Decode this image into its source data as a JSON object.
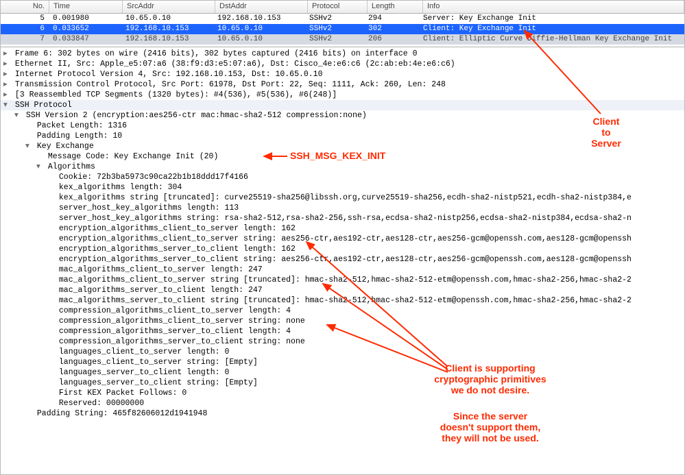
{
  "columns": [
    "No.",
    "Time",
    "SrcAddr",
    "DstAddr",
    "Protocol",
    "Length",
    "Info"
  ],
  "rows": [
    {
      "no": "5",
      "time": "0.001980",
      "src": "10.65.0.10",
      "dst": "192.168.10.153",
      "proto": "SSHv2",
      "len": "294",
      "info": "Server: Key Exchange Init",
      "state": "plain"
    },
    {
      "no": "6",
      "time": "0.033652",
      "src": "192.168.10.153",
      "dst": "10.65.0.10",
      "proto": "SSHv2",
      "len": "302",
      "info": "Client: Key Exchange Init",
      "state": "selected"
    },
    {
      "no": "7",
      "time": "0.033847",
      "src": "192.168.10.153",
      "dst": "10.65.0.10",
      "proto": "SSHv2",
      "len": "206",
      "info": "Client: Elliptic Curve Diffie-Hellman Key Exchange Init",
      "state": "dim"
    }
  ],
  "tree": [
    {
      "t": ">",
      "d": 0,
      "txt": "Frame 6: 302 bytes on wire (2416 bits), 302 bytes captured (2416 bits) on interface 0"
    },
    {
      "t": ">",
      "d": 0,
      "txt": "Ethernet II, Src: Apple_e5:07:a6 (38:f9:d3:e5:07:a6), Dst: Cisco_4e:e6:c6 (2c:ab:eb:4e:e6:c6)"
    },
    {
      "t": ">",
      "d": 0,
      "txt": "Internet Protocol Version 4, Src: 192.168.10.153, Dst: 10.65.0.10"
    },
    {
      "t": ">",
      "d": 0,
      "txt": "Transmission Control Protocol, Src Port: 61978, Dst Port: 22, Seq: 1111, Ack: 260, Len: 248"
    },
    {
      "t": ">",
      "d": 0,
      "txt": "[3 Reassembled TCP Segments (1320 bytes): #4(536), #5(536), #6(248)]"
    },
    {
      "t": "v",
      "d": 0,
      "txt": "SSH Protocol",
      "hl": true
    },
    {
      "t": "v",
      "d": 1,
      "txt": "SSH Version 2 (encryption:aes256-ctr mac:hmac-sha2-512 compression:none)"
    },
    {
      "t": " ",
      "d": 2,
      "txt": "Packet Length: 1316"
    },
    {
      "t": " ",
      "d": 2,
      "txt": "Padding Length: 10"
    },
    {
      "t": "v",
      "d": 2,
      "txt": "Key Exchange"
    },
    {
      "t": " ",
      "d": 3,
      "txt": "Message Code: Key Exchange Init (20)"
    },
    {
      "t": "v",
      "d": 3,
      "txt": "Algorithms"
    },
    {
      "t": " ",
      "d": 4,
      "txt": "Cookie: 72b3ba5973c90ca22b1b18ddd17f4166"
    },
    {
      "t": " ",
      "d": 4,
      "txt": "kex_algorithms length: 304"
    },
    {
      "t": " ",
      "d": 4,
      "txt": "kex_algorithms string [truncated]: curve25519-sha256@libssh.org,curve25519-sha256,ecdh-sha2-nistp521,ecdh-sha2-nistp384,e"
    },
    {
      "t": " ",
      "d": 4,
      "txt": "server_host_key_algorithms length: 113"
    },
    {
      "t": " ",
      "d": 4,
      "txt": "server_host_key_algorithms string: rsa-sha2-512,rsa-sha2-256,ssh-rsa,ecdsa-sha2-nistp256,ecdsa-sha2-nistp384,ecdsa-sha2-n"
    },
    {
      "t": " ",
      "d": 4,
      "txt": "encryption_algorithms_client_to_server length: 162"
    },
    {
      "t": " ",
      "d": 4,
      "txt": "encryption_algorithms_client_to_server string: aes256-ctr,aes192-ctr,aes128-ctr,aes256-gcm@openssh.com,aes128-gcm@openssh"
    },
    {
      "t": " ",
      "d": 4,
      "txt": "encryption_algorithms_server_to_client length: 162"
    },
    {
      "t": " ",
      "d": 4,
      "txt": "encryption_algorithms_server_to_client string: aes256-ctr,aes192-ctr,aes128-ctr,aes256-gcm@openssh.com,aes128-gcm@openssh"
    },
    {
      "t": " ",
      "d": 4,
      "txt": "mac_algorithms_client_to_server length: 247"
    },
    {
      "t": " ",
      "d": 4,
      "txt": "mac_algorithms_client_to_server string [truncated]: hmac-sha2-512,hmac-sha2-512-etm@openssh.com,hmac-sha2-256,hmac-sha2-2"
    },
    {
      "t": " ",
      "d": 4,
      "txt": "mac_algorithms_server_to_client length: 247"
    },
    {
      "t": " ",
      "d": 4,
      "txt": "mac_algorithms_server_to_client string [truncated]: hmac-sha2-512,hmac-sha2-512-etm@openssh.com,hmac-sha2-256,hmac-sha2-2"
    },
    {
      "t": " ",
      "d": 4,
      "txt": "compression_algorithms_client_to_server length: 4"
    },
    {
      "t": " ",
      "d": 4,
      "txt": "compression_algorithms_client_to_server string: none"
    },
    {
      "t": " ",
      "d": 4,
      "txt": "compression_algorithms_server_to_client length: 4"
    },
    {
      "t": " ",
      "d": 4,
      "txt": "compression_algorithms_server_to_client string: none"
    },
    {
      "t": " ",
      "d": 4,
      "txt": "languages_client_to_server length: 0"
    },
    {
      "t": " ",
      "d": 4,
      "txt": "languages_client_to_server string: [Empty]"
    },
    {
      "t": " ",
      "d": 4,
      "txt": "languages_server_to_client length: 0"
    },
    {
      "t": " ",
      "d": 4,
      "txt": "languages_server_to_client string: [Empty]"
    },
    {
      "t": " ",
      "d": 4,
      "txt": "First KEX Packet Follows: 0"
    },
    {
      "t": " ",
      "d": 4,
      "txt": "Reserved: 00000000"
    },
    {
      "t": " ",
      "d": 2,
      "txt": "Padding String: 465f82606012d1941948"
    }
  ],
  "annotations": {
    "kex_init_label": "SSH_MSG_KEX_INIT",
    "client_to_server": "Client\nto\nServer",
    "support_text": "Client is supporting\ncryptographic primitives\nwe do not desire.",
    "server_text": "Since the server\ndoesn't support them,\nthey will not be used."
  }
}
